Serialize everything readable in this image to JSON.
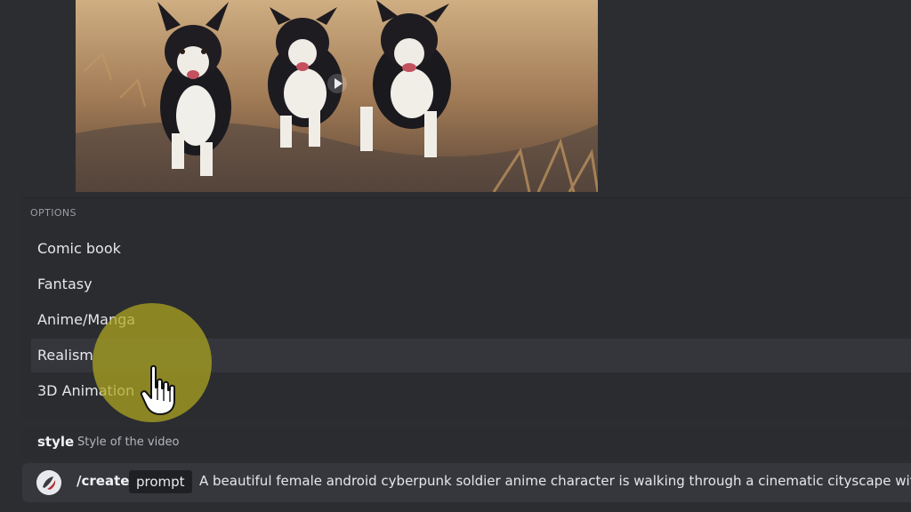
{
  "media": {
    "description_icon": "play-icon"
  },
  "options": {
    "header": "OPTIONS",
    "items": [
      {
        "label": "Comic book"
      },
      {
        "label": "Fantasy"
      },
      {
        "label": "Anime/Manga"
      },
      {
        "label": "Realism"
      },
      {
        "label": "3D Animation"
      }
    ],
    "highlighted_index": 3
  },
  "hint": {
    "name": "style",
    "description": "Style of the video"
  },
  "input": {
    "command": "/create",
    "param": "prompt",
    "value": "A beautiful female android cyberpunk soldier anime character is walking through a cinematic cityscape with bo"
  },
  "colors": {
    "background": "#2c2d31",
    "highlight": "#35363b",
    "halo": "#b0a820"
  }
}
